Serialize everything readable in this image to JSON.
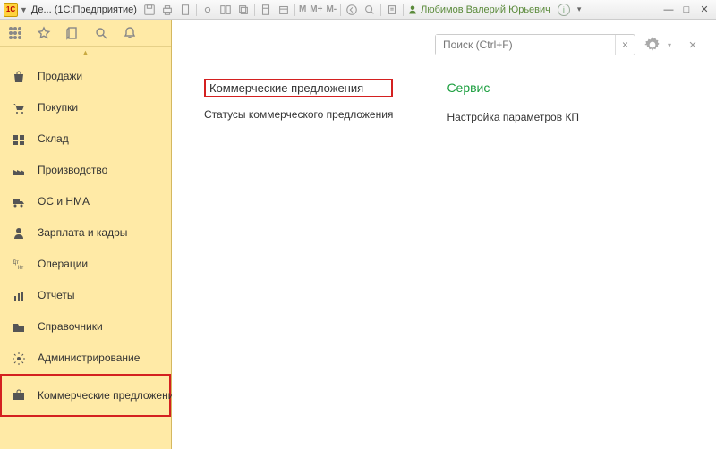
{
  "titlebar": {
    "logo_text": "1C",
    "title": "Де...  (1С:Предприятие)",
    "user_name": "Любимов Валерий Юрьевич",
    "m_labels": [
      "M",
      "M+",
      "M-"
    ],
    "info_char": "i"
  },
  "sidebar": {
    "items": [
      {
        "label": "Продажи"
      },
      {
        "label": "Покупки"
      },
      {
        "label": "Склад"
      },
      {
        "label": "Производство"
      },
      {
        "label": "ОС и НМА"
      },
      {
        "label": "Зарплата и кадры"
      },
      {
        "label": "Операции"
      },
      {
        "label": "Отчеты"
      },
      {
        "label": "Справочники"
      },
      {
        "label": "Администрирование"
      },
      {
        "label": "Коммерческие предложения"
      }
    ]
  },
  "search": {
    "placeholder": "Поиск (Ctrl+F)",
    "clear": "×"
  },
  "content": {
    "left": {
      "main_link": "Коммерческие предложения",
      "sub_link": "Статусы коммерческого предложения"
    },
    "right": {
      "title": "Сервис",
      "link": "Настройка параметров КП"
    }
  }
}
